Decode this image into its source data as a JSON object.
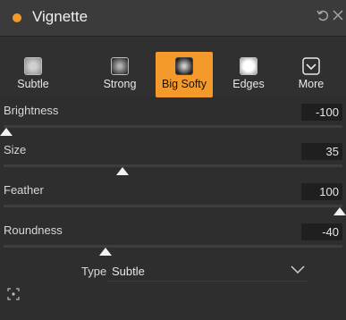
{
  "header": {
    "title": "Vignette",
    "dot_color": "#f39a2a",
    "reset_icon": "undo-icon",
    "close_icon": "close-icon"
  },
  "presets": [
    {
      "label": "Subtle",
      "icon": "vignette-subtle-icon",
      "active": false
    },
    {
      "label": "Strong",
      "icon": "vignette-strong-icon",
      "active": false
    },
    {
      "label": "Big Softy",
      "icon": "vignette-big-softy-icon",
      "active": true
    },
    {
      "label": "Edges",
      "icon": "vignette-edges-icon",
      "active": false
    },
    {
      "label": "More",
      "icon": "chevron-down-icon",
      "active": false
    }
  ],
  "sliders": [
    {
      "label": "Brightness",
      "value": "-100",
      "position": 0.0
    },
    {
      "label": "Size",
      "value": "35",
      "position": 0.35
    },
    {
      "label": "Feather",
      "value": "100",
      "position": 1.0
    },
    {
      "label": "Roundness",
      "value": "-40",
      "position": 0.3
    }
  ],
  "type": {
    "label": "Type",
    "value": "Subtle"
  },
  "accent_color": "#f39a2a"
}
